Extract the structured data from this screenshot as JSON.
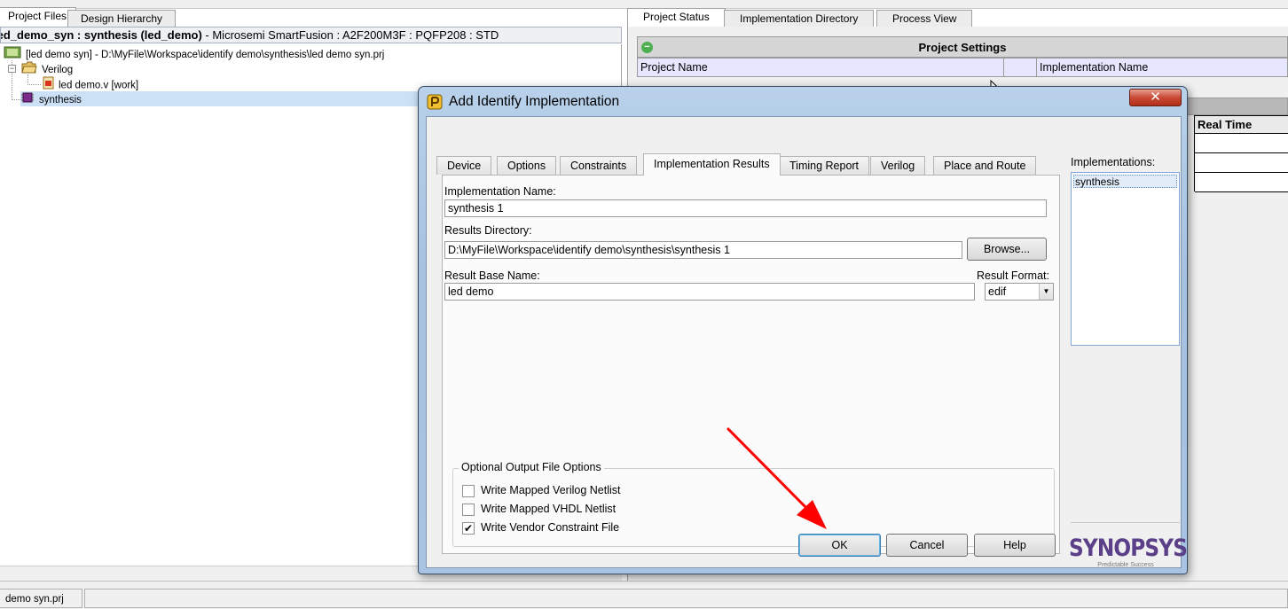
{
  "left_pane": {
    "tabs": [
      "Project Files",
      "Design Hierarchy"
    ],
    "title_bold": "led_demo_syn : synthesis (led_demo)",
    "title_rest": " - Microsemi SmartFusion : A2F200M3F : PQFP208 : STD",
    "tree": {
      "project": "[led  demo  syn]  -  D:\\MyFile\\Workspace\\identify  demo\\synthesis\\led  demo  syn.prj",
      "folder": "Verilog",
      "file": "led  demo.v [work]",
      "impl": "synthesis"
    }
  },
  "right_pane": {
    "tabs": [
      "Project Status",
      "Implementation Directory",
      "Process View"
    ],
    "settings_header": "Project Settings",
    "row_labels": [
      "Project Name",
      "Implementation Name"
    ],
    "table2_header": "Real Time"
  },
  "status_bar": {
    "file": "demo  syn.prj"
  },
  "dialog": {
    "title": "Add Identify Implementation",
    "close_glyph": "✕",
    "tabs": [
      "Device",
      "Options",
      "Constraints",
      "Implementation Results",
      "Timing Report",
      "Verilog",
      "Place and Route"
    ],
    "active_tab": "Implementation Results",
    "impl_name_label": "Implementation Name:",
    "impl_name_value": "synthesis  1",
    "results_dir_label": "Results Directory:",
    "results_dir_value": "D:\\MyFile\\Workspace\\identify  demo\\synthesis\\synthesis  1",
    "browse_label": "Browse...",
    "base_name_label": "Result Base Name:",
    "base_name_value": "led  demo",
    "format_label": "Result Format:",
    "format_value": "edif",
    "output_group_label": "Optional Output File Options",
    "options": [
      {
        "label": "Write Mapped Verilog Netlist",
        "checked": false
      },
      {
        "label": "Write Mapped VHDL Netlist",
        "checked": false
      },
      {
        "label": "Write Vendor Constraint File",
        "checked": true
      }
    ],
    "implementations_label": "Implementations:",
    "implementations": [
      "synthesis"
    ],
    "brand_name": "SYNOPSYS",
    "brand_tagline": "Predictable Success",
    "buttons": {
      "ok": "OK",
      "cancel": "Cancel",
      "help": "Help"
    }
  },
  "colors": {
    "annotation_arrow": "#ff0000",
    "brand": "#5b3f88",
    "selected_row": "#cce0f6"
  }
}
